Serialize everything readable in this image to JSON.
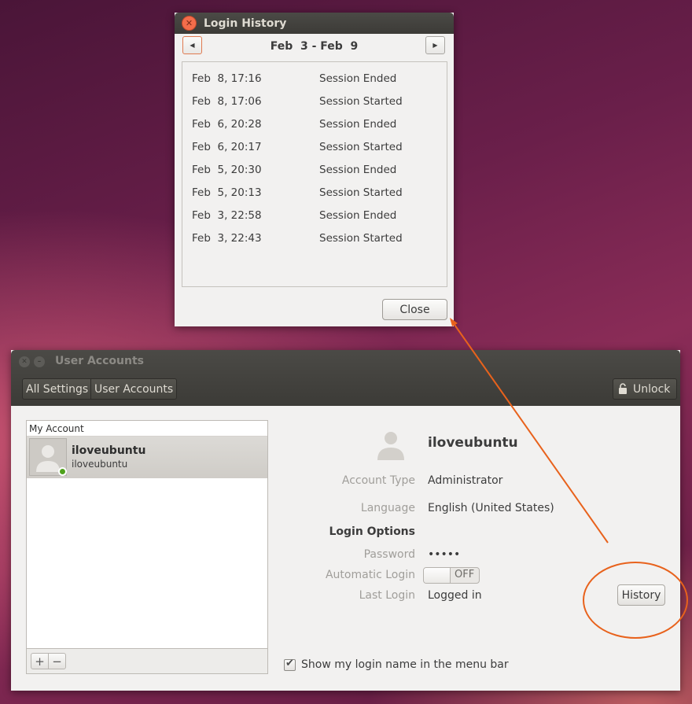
{
  "login_history": {
    "title": "Login History",
    "range": "Feb  3 - Feb  9",
    "prev_icon": "triangle-left-icon",
    "next_icon": "triangle-right-icon",
    "entries": [
      {
        "date": "Feb  8, 17:16",
        "event": "Session Ended"
      },
      {
        "date": "Feb  8, 17:06",
        "event": "Session Started"
      },
      {
        "date": "Feb  6, 20:28",
        "event": "Session Ended"
      },
      {
        "date": "Feb  6, 20:17",
        "event": "Session Started"
      },
      {
        "date": "Feb  5, 20:30",
        "event": "Session Ended"
      },
      {
        "date": "Feb  5, 20:13",
        "event": "Session Started"
      },
      {
        "date": "Feb  3, 22:58",
        "event": "Session Ended"
      },
      {
        "date": "Feb  3, 22:43",
        "event": "Session Started"
      }
    ],
    "close_label": "Close"
  },
  "user_accounts": {
    "title": "User Accounts",
    "breadcrumbs": [
      "All Settings",
      "User Accounts"
    ],
    "unlock_label": "Unlock",
    "list_header": "My Account",
    "user": {
      "display_name": "iloveubuntu",
      "login": "iloveubuntu",
      "status": "online"
    },
    "details": {
      "name": "iloveubuntu",
      "account_type_label": "Account Type",
      "account_type": "Administrator",
      "language_label": "Language",
      "language": "English (United States)",
      "login_options_heading": "Login Options",
      "password_label": "Password",
      "password": "•••••",
      "auto_login_label": "Automatic Login",
      "auto_login_state": "OFF",
      "last_login_label": "Last Login",
      "last_login": "Logged in",
      "history_label": "History"
    },
    "show_login_name_label": "Show my login name in the menu bar",
    "show_login_name_checked": true
  },
  "annotation_color": "#e8621c",
  "accent_close": "#f36d4b"
}
